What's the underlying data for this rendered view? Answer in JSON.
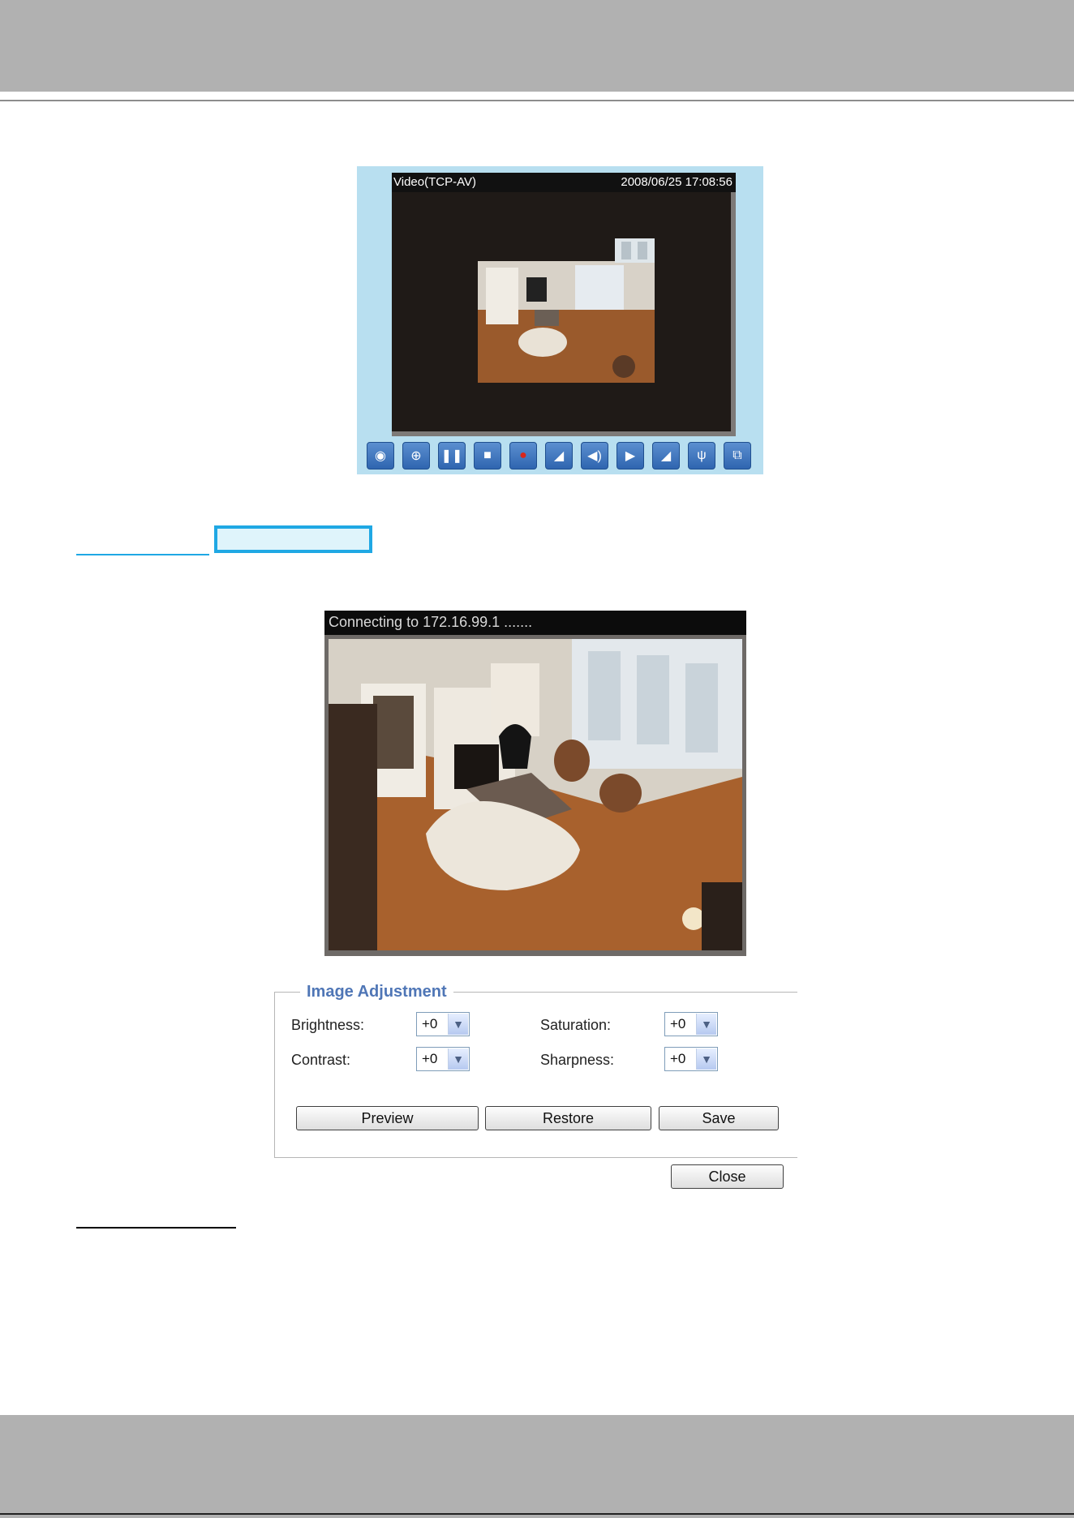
{
  "viewer": {
    "stream_label": "Video(TCP-AV)",
    "timestamp": "2008/06/25 17:08:56",
    "toolbar": [
      {
        "icon": "snapshot-icon",
        "glyph": "◉"
      },
      {
        "icon": "digital-zoom-icon",
        "glyph": "⊕"
      },
      {
        "icon": "pause-icon",
        "glyph": "❚❚"
      },
      {
        "icon": "stop-icon",
        "glyph": "■"
      },
      {
        "icon": "record-icon",
        "glyph": "●"
      },
      {
        "icon": "volume-icon",
        "glyph": "◢"
      },
      {
        "icon": "speaker-icon",
        "glyph": "◀)"
      },
      {
        "icon": "talk-icon",
        "glyph": "▶"
      },
      {
        "icon": "mic-volume-icon",
        "glyph": "◢"
      },
      {
        "icon": "microphone-icon",
        "glyph": "ψ"
      },
      {
        "icon": "fullscreen-icon",
        "glyph": "⧉"
      }
    ]
  },
  "live": {
    "status": "Connecting to 172.16.99.1 ......."
  },
  "image_adjustment": {
    "legend": "Image Adjustment",
    "brightness_label": "Brightness:",
    "brightness_value": "+0",
    "contrast_label": "Contrast:",
    "contrast_value": "+0",
    "saturation_label": "Saturation:",
    "saturation_value": "+0",
    "sharpness_label": "Sharpness:",
    "sharpness_value": "+0",
    "preview_label": "Preview",
    "restore_label": "Restore",
    "save_label": "Save",
    "close_label": "Close"
  },
  "colors": {
    "header_gray": "#b1b1b1",
    "viewer_bg": "#b8dff0",
    "highlight_blue": "#1fa8e4",
    "legend_blue": "#4f76b6"
  }
}
